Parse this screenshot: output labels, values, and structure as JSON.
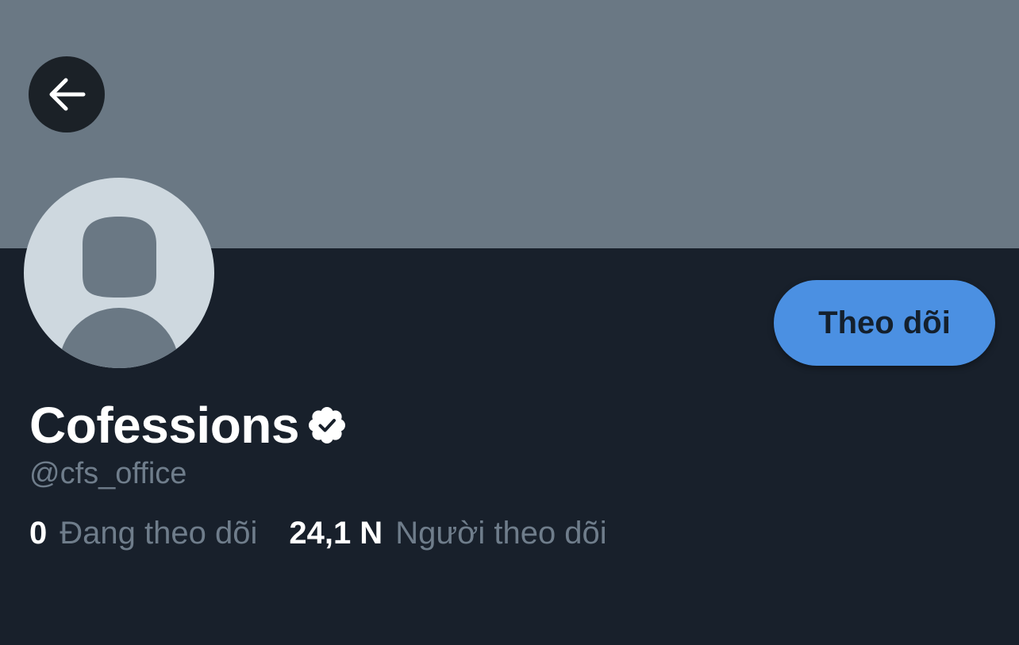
{
  "header": {
    "back_icon": "arrow-left-icon"
  },
  "profile": {
    "avatar": "default-avatar-placeholder",
    "display_name": "Cofessions",
    "verified_icon": "verified-badge-icon",
    "handle": "@cfs_office",
    "follow_label": "Theo dõi"
  },
  "stats": {
    "following_count": "0",
    "following_label": "Đang theo dõi",
    "followers_count": "24,1 N",
    "followers_label": "Người theo dõi"
  },
  "colors": {
    "background": "#18202b",
    "banner": "#6a7884",
    "accent": "#4b90e2",
    "muted_text": "#6f7d8b",
    "avatar_bg": "#ced8df"
  }
}
